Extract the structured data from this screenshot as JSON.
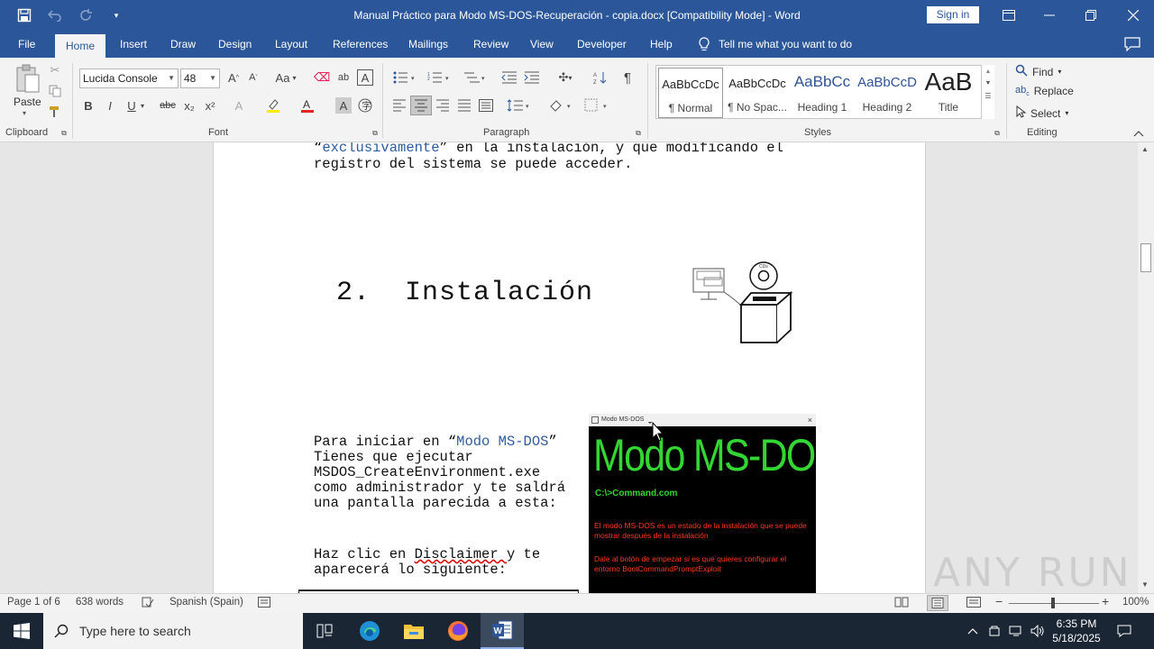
{
  "window": {
    "title": "Manual Práctico para Modo MS-DOS-Recuperación - copia.docx [Compatibility Mode]  -  Word",
    "sign_in": "Sign in"
  },
  "tabs": [
    "File",
    "Home",
    "Insert",
    "Draw",
    "Design",
    "Layout",
    "References",
    "Mailings",
    "Review",
    "View",
    "Developer",
    "Help"
  ],
  "tell_me": "Tell me what you want to do",
  "ribbon": {
    "clipboard": {
      "paste": "Paste",
      "label": "Clipboard"
    },
    "font": {
      "name": "Lucida Console",
      "size": "48",
      "label": "Font",
      "change_case": "Aa",
      "bold": "B",
      "italic": "I",
      "underline": "U",
      "strike": "abc",
      "sub": "x₂",
      "sup": "x²"
    },
    "paragraph": {
      "label": "Paragraph"
    },
    "styles": {
      "label": "Styles",
      "items": [
        {
          "sample": "AaBbCcDc",
          "name": "¶ Normal"
        },
        {
          "sample": "AaBbCcDc",
          "name": "¶ No Spac..."
        },
        {
          "sample": "AaBbCc",
          "name": "Heading 1"
        },
        {
          "sample": "AaBbCcD",
          "name": "Heading 2"
        },
        {
          "sample": "AaB",
          "name": "Title"
        }
      ]
    },
    "editing": {
      "label": "Editing",
      "find": "Find",
      "replace": "Replace",
      "select": "Select"
    }
  },
  "document": {
    "top_line1_open": "“",
    "top_line1_word": "exclusivamente",
    "top_line1_rest": "” en la instalación, y que modificando el",
    "top_line2": "registro del sistema se puede acceder.",
    "heading": "2.  Instalación",
    "p1_l1_a": "Para iniciar en “",
    "p1_l1_b": "Modo MS-DOS",
    "p1_l1_c": "”",
    "p1_l2": "Tienes que ejecutar",
    "p1_l3": "MSDOS_CreateEnvironment.exe",
    "p1_l4": "como administrador y te saldrá",
    "p1_l5": "una pantalla parecida a esta:",
    "p2_l1_a": "Haz clic en ",
    "p2_l1_b": "Disclaimer ",
    "p2_l1_c": "y te",
    "p2_l2": "aparecerá lo siguiente:",
    "msdos_window": {
      "title": "Modo MS-DOS",
      "close": "×",
      "big": "Modo MS-DOS",
      "cmd": "C:\\>Command.com",
      "text1": "El modo MS-DOS es un estado de la instalación que se puede mostrar después de la instalación",
      "text2": "Dale al botón de empezar si es que quieres configurar el entorno BootCommandPromptExploit"
    },
    "illustration_label": "CDs"
  },
  "status": {
    "page": "Page 1 of 6",
    "words": "638 words",
    "language": "Spanish (Spain)",
    "zoom": "100%"
  },
  "watermark": "ANY RUN",
  "taskbar": {
    "search_placeholder": "Type here to search",
    "time": "6:35 PM",
    "date": "5/18/2025"
  }
}
